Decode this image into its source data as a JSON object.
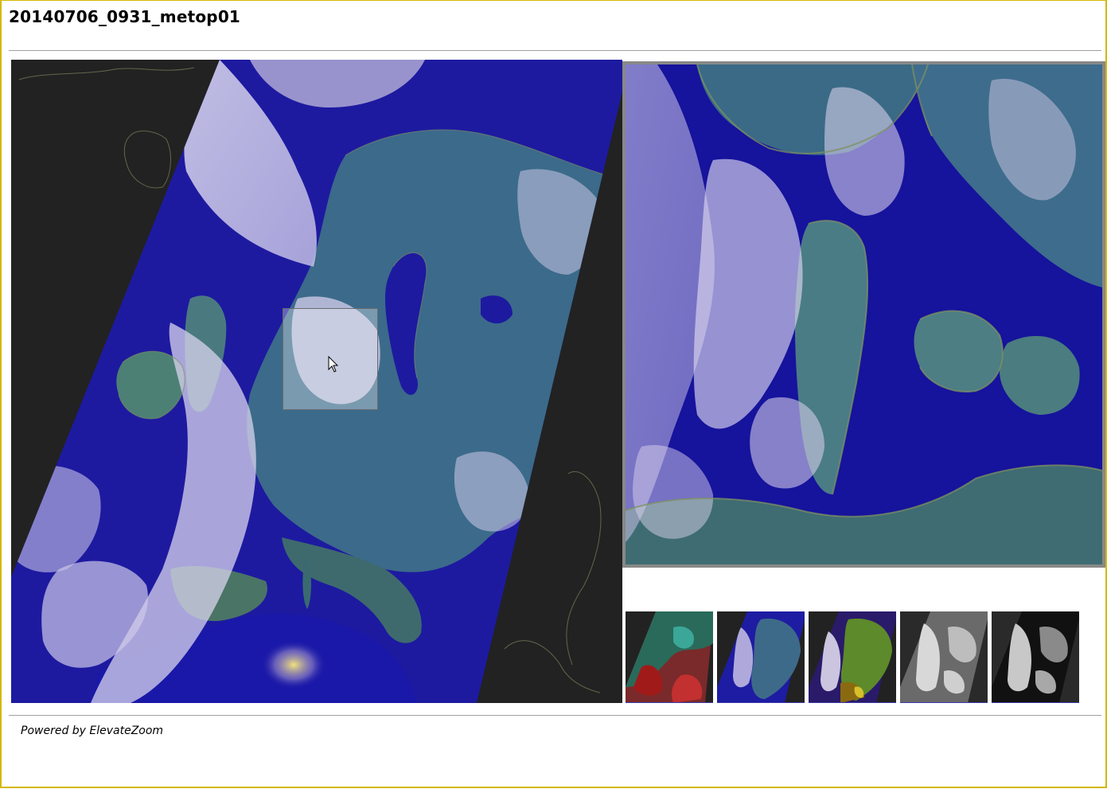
{
  "page": {
    "title": "20140706_0931_metop01"
  },
  "viewer": {
    "main_image_name": "satellite-composite",
    "thumbnails": [
      {
        "name": "thumbnail-false-color-red"
      },
      {
        "name": "thumbnail-natural-blue"
      },
      {
        "name": "thumbnail-vegetation-green"
      },
      {
        "name": "thumbnail-visible-gray"
      },
      {
        "name": "thumbnail-infrared-dark"
      }
    ]
  },
  "footer": {
    "credit": "Powered by ElevateZoom"
  },
  "colors": {
    "border_accent": "#d4b800",
    "background_dark": "#222222",
    "sea_blue": "#14129a"
  }
}
